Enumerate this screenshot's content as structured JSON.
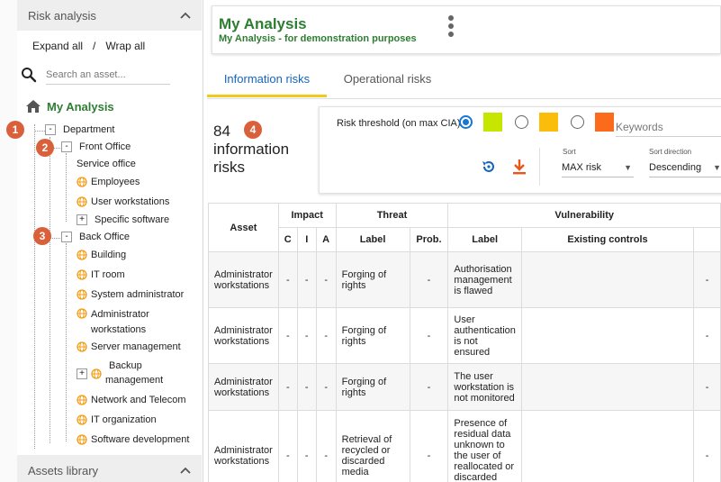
{
  "sidebar": {
    "risk_panel_title": "Risk analysis",
    "assets_panel_title": "Assets library",
    "expand_all": "Expand all",
    "separator": "/",
    "wrap_all": "Wrap all",
    "search_placeholder": "Search an asset...",
    "root_label": "My Analysis",
    "tree": {
      "department": "Department",
      "front_office": "Front Office",
      "service_office": "Service office",
      "employees": "Employees",
      "user_workstations": "User workstations",
      "specific_software": "Specific software",
      "back_office": "Back Office",
      "building": "Building",
      "it_room": "IT room",
      "system_administrator": "System administrator",
      "administrator_workstations_1": "Administrator",
      "administrator_workstations_2": "workstations",
      "server_management": "Server management",
      "backup_management_1": "Backup",
      "backup_management_2": "management",
      "network_telecom": "Network and Telecom",
      "it_organization": "IT organization",
      "software_development": "Software development"
    },
    "badges": [
      "1",
      "2",
      "3"
    ]
  },
  "header": {
    "title": "My Analysis",
    "subtitle": "My Analysis - for demonstration purposes"
  },
  "tabs": [
    {
      "label": "Information risks",
      "active": true
    },
    {
      "label": "Operational risks",
      "active": false
    }
  ],
  "summary": {
    "count": "84",
    "line1": "information",
    "line2": "risks",
    "badge": "4"
  },
  "filters": {
    "threshold_label": "Risk threshold (on max CIA)",
    "threshold_colors": [
      "#c6e600",
      "#fbbd0c",
      "#fb6b1b"
    ],
    "selected_threshold": 0,
    "keywords_placeholder": "Keywords",
    "sort_label": "Sort",
    "sort_value": "MAX risk",
    "direction_label": "Sort direction",
    "direction_value": "Descending"
  },
  "table": {
    "headers": {
      "asset": "Asset",
      "impact": "Impact",
      "threat": "Threat",
      "vulnerability": "Vulnerability",
      "c": "C",
      "i": "I",
      "a": "A",
      "threat_label": "Label",
      "prob": "Prob.",
      "vuln_label": "Label",
      "existing_controls": "Existing controls"
    },
    "rows": [
      {
        "asset": "Administrator workstations",
        "c": "-",
        "i": "-",
        "a": "-",
        "threat": "Forging of rights",
        "prob": "-",
        "vuln": "Authorisation management is flawed",
        "controls": "",
        "last": "-"
      },
      {
        "asset": "Administrator workstations",
        "c": "-",
        "i": "-",
        "a": "-",
        "threat": "Forging of rights",
        "prob": "-",
        "vuln": "User authentication is not ensured",
        "controls": "",
        "last": "-"
      },
      {
        "asset": "Administrator workstations",
        "c": "-",
        "i": "-",
        "a": "-",
        "threat": "Forging of rights",
        "prob": "-",
        "vuln": "The user workstation is not monitored",
        "controls": "",
        "last": "-"
      },
      {
        "asset": "Administrator workstations",
        "c": "-",
        "i": "-",
        "a": "-",
        "threat": "Retrieval of recycled or discarded media",
        "prob": "-",
        "vuln": "Presence of residual data unknown to the user of reallocated or discarded equipment",
        "controls": "",
        "last": "-"
      }
    ]
  },
  "colors": {
    "brand_green": "#2e7d32",
    "tab_active_text": "#1565c0",
    "tab_indicator": "#f2c91f",
    "badge": "#d9603b"
  }
}
